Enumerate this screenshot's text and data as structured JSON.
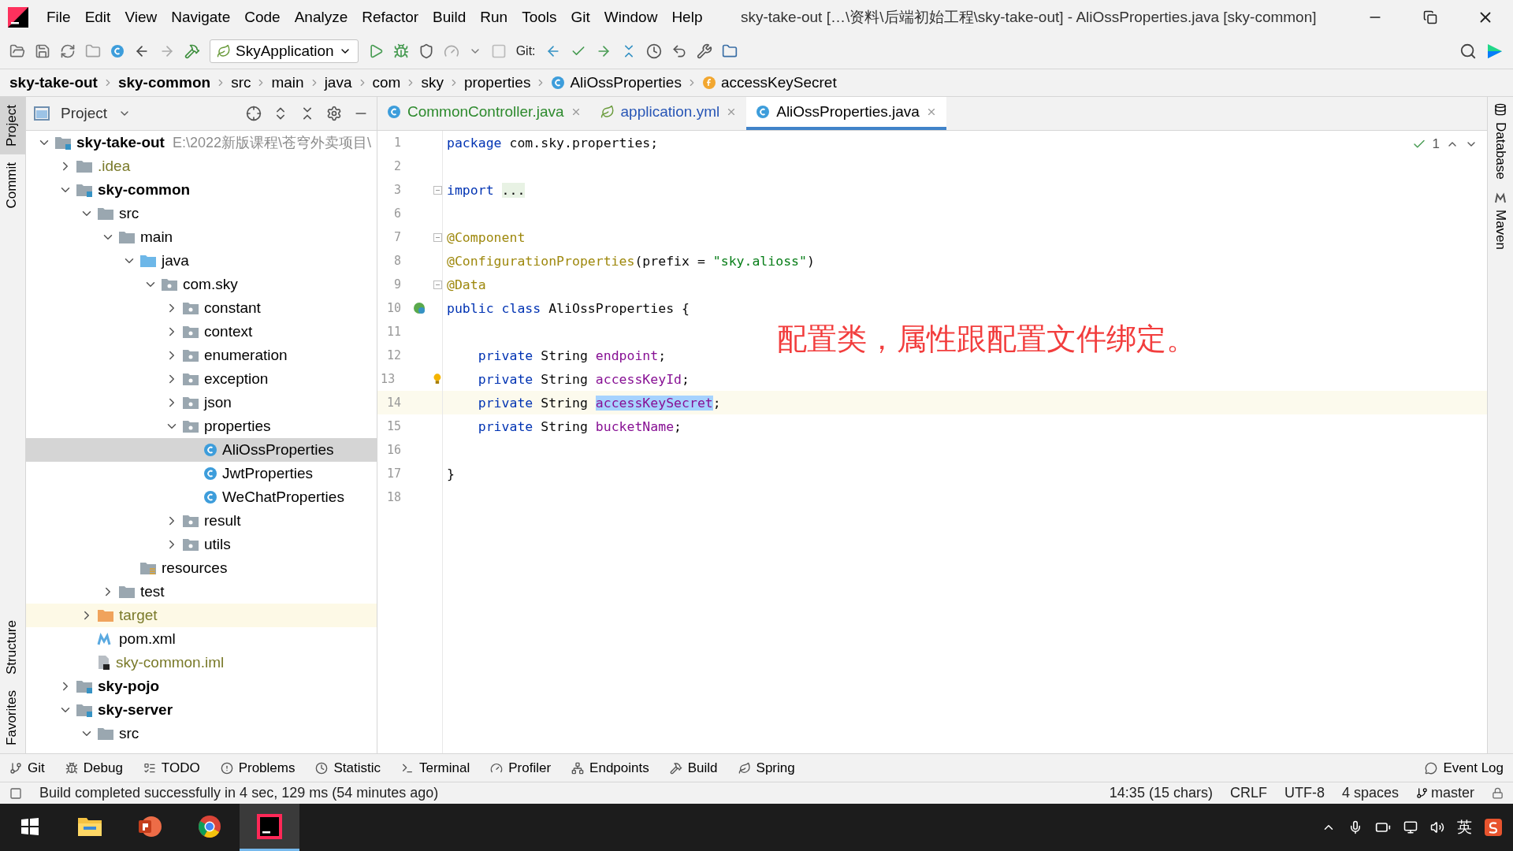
{
  "window": {
    "title": "sky-take-out […\\资料\\后端初始工程\\sky-take-out] - AliOssProperties.java [sky-common]",
    "menu": [
      "File",
      "Edit",
      "View",
      "Navigate",
      "Code",
      "Analyze",
      "Refactor",
      "Build",
      "Run",
      "Tools",
      "Git",
      "Window",
      "Help"
    ]
  },
  "toolbar": {
    "run_config": "SkyApplication",
    "git_label": "Git:"
  },
  "breadcrumbs": [
    {
      "label": "sky-take-out",
      "kind": "module"
    },
    {
      "label": "sky-common",
      "kind": "module"
    },
    {
      "label": "src",
      "kind": "dir"
    },
    {
      "label": "main",
      "kind": "dir"
    },
    {
      "label": "java",
      "kind": "dir"
    },
    {
      "label": "com",
      "kind": "dir"
    },
    {
      "label": "sky",
      "kind": "dir"
    },
    {
      "label": "properties",
      "kind": "dir"
    },
    {
      "label": "AliOssProperties",
      "kind": "class"
    },
    {
      "label": "accessKeySecret",
      "kind": "field"
    }
  ],
  "left_stripe": {
    "top": [
      {
        "label": "Project",
        "selected": true
      },
      {
        "label": "Commit",
        "selected": false
      }
    ],
    "bottom": [
      {
        "label": "Structure",
        "selected": false
      },
      {
        "label": "Favorites",
        "selected": false
      }
    ]
  },
  "project": {
    "title": "Project",
    "tree": [
      {
        "label": "sky-take-out",
        "kind": "module",
        "path": "E:\\2022新版课程\\苍穹外卖项目\\",
        "expanded": true,
        "selected": false,
        "ignored": false,
        "children": [
          {
            "label": ".idea",
            "kind": "folder",
            "expanded": false,
            "selected": false,
            "ignored": true
          },
          {
            "label": "sky-common",
            "kind": "module",
            "expanded": true,
            "selected": false,
            "ignored": false,
            "children": [
              {
                "label": "src",
                "kind": "folder",
                "expanded": true,
                "selected": false,
                "ignored": false,
                "children": [
                  {
                    "label": "main",
                    "kind": "folder",
                    "expanded": true,
                    "selected": false,
                    "ignored": false,
                    "children": [
                      {
                        "label": "java",
                        "kind": "source",
                        "expanded": true,
                        "selected": false,
                        "ignored": false,
                        "children": [
                          {
                            "label": "com.sky",
                            "kind": "package",
                            "expanded": true,
                            "selected": false,
                            "ignored": false,
                            "children": [
                              {
                                "label": "constant",
                                "kind": "package",
                                "expanded": false,
                                "selected": false,
                                "ignored": false
                              },
                              {
                                "label": "context",
                                "kind": "package",
                                "expanded": false,
                                "selected": false,
                                "ignored": false
                              },
                              {
                                "label": "enumeration",
                                "kind": "package",
                                "expanded": false,
                                "selected": false,
                                "ignored": false
                              },
                              {
                                "label": "exception",
                                "kind": "package",
                                "expanded": false,
                                "selected": false,
                                "ignored": false
                              },
                              {
                                "label": "json",
                                "kind": "package",
                                "expanded": false,
                                "selected": false,
                                "ignored": false
                              },
                              {
                                "label": "properties",
                                "kind": "package",
                                "expanded": true,
                                "selected": false,
                                "ignored": false,
                                "children": [
                                  {
                                    "label": "AliOssProperties",
                                    "kind": "class",
                                    "selected": true,
                                    "ignored": false
                                  },
                                  {
                                    "label": "JwtProperties",
                                    "kind": "class",
                                    "selected": false,
                                    "ignored": false
                                  },
                                  {
                                    "label": "WeChatProperties",
                                    "kind": "class",
                                    "selected": false,
                                    "ignored": false
                                  }
                                ]
                              },
                              {
                                "label": "result",
                                "kind": "package",
                                "expanded": false,
                                "selected": false,
                                "ignored": false
                              },
                              {
                                "label": "utils",
                                "kind": "package",
                                "expanded": false,
                                "selected": false,
                                "ignored": false
                              }
                            ]
                          }
                        ]
                      },
                      {
                        "label": "resources",
                        "kind": "resources",
                        "selected": false,
                        "ignored": false
                      }
                    ]
                  },
                  {
                    "label": "test",
                    "kind": "folder",
                    "expanded": false,
                    "selected": false,
                    "ignored": false
                  }
                ]
              },
              {
                "label": "target",
                "kind": "excluded",
                "expanded": false,
                "selected": false,
                "ignored": true
              },
              {
                "label": "pom.xml",
                "kind": "maven",
                "selected": false,
                "ignored": false
              },
              {
                "label": "sky-common.iml",
                "kind": "iml",
                "selected": false,
                "ignored": true
              }
            ]
          },
          {
            "label": "sky-pojo",
            "kind": "module",
            "expanded": false,
            "selected": false,
            "ignored": false
          },
          {
            "label": "sky-server",
            "kind": "module",
            "expanded": true,
            "selected": false,
            "ignored": false,
            "children": [
              {
                "label": "src",
                "kind": "folder",
                "expanded": true,
                "selected": false,
                "ignored": false
              }
            ]
          }
        ]
      }
    ]
  },
  "editor": {
    "tabs": [
      {
        "label": "CommonController.java",
        "kind": "java",
        "color": "#2d8a2d",
        "selected": false
      },
      {
        "label": "application.yml",
        "kind": "yml",
        "color": "#2856b6",
        "selected": false
      },
      {
        "label": "AliOssProperties.java",
        "kind": "java",
        "color": "#000000",
        "selected": true
      }
    ],
    "problems": "1",
    "lines": [
      {
        "number": "1",
        "kind": "plain",
        "current": false,
        "fold": false,
        "segments": [
          {
            "text": "package ",
            "kind": "keyword"
          },
          {
            "text": "com.sky.properties;",
            "kind": "plain"
          }
        ]
      },
      {
        "number": "2",
        "kind": "plain",
        "current": false,
        "fold": false
      },
      {
        "number": "3",
        "kind": "plain",
        "current": false,
        "fold": true,
        "segments": [
          {
            "text": "import ",
            "kind": "keyword"
          },
          {
            "text": "...",
            "kind": "folded"
          }
        ]
      },
      {
        "number": "6",
        "kind": "plain",
        "current": false,
        "fold": false
      },
      {
        "number": "7",
        "kind": "plain",
        "current": false,
        "fold": true,
        "segments": [
          {
            "text": "@Component",
            "kind": "annotation"
          }
        ]
      },
      {
        "number": "8",
        "kind": "plain",
        "current": false,
        "fold": false,
        "segments": [
          {
            "text": "@ConfigurationProperties",
            "kind": "annotation"
          },
          {
            "text": "(prefix = ",
            "kind": "plain"
          },
          {
            "text": "\"sky.alioss\"",
            "kind": "string"
          },
          {
            "text": ")",
            "kind": "plain"
          }
        ]
      },
      {
        "number": "9",
        "kind": "plain",
        "current": false,
        "fold": true,
        "segments": [
          {
            "text": "@Data",
            "kind": "annotation"
          }
        ]
      },
      {
        "number": "10",
        "kind": "bean",
        "current": false,
        "fold": false,
        "segments": [
          {
            "text": "public class ",
            "kind": "keyword"
          },
          {
            "text": "AliOssProperties {",
            "kind": "plain"
          }
        ]
      },
      {
        "number": "11",
        "kind": "plain",
        "current": false,
        "fold": false
      },
      {
        "number": "12",
        "kind": "plain",
        "current": false,
        "fold": false,
        "segments": [
          {
            "text": "    private ",
            "kind": "keyword"
          },
          {
            "text": "String ",
            "kind": "plain"
          },
          {
            "text": "endpoint",
            "kind": "field"
          },
          {
            "text": ";",
            "kind": "plain"
          }
        ]
      },
      {
        "number": "13",
        "kind": "bulb",
        "current": false,
        "fold": false,
        "segments": [
          {
            "text": "    private ",
            "kind": "keyword"
          },
          {
            "text": "String ",
            "kind": "plain"
          },
          {
            "text": "accessKeyId",
            "kind": "field"
          },
          {
            "text": ";",
            "kind": "plain"
          }
        ]
      },
      {
        "number": "14",
        "kind": "plain",
        "current": true,
        "fold": false,
        "segments": [
          {
            "text": "    private ",
            "kind": "keyword"
          },
          {
            "text": "String ",
            "kind": "plain"
          },
          {
            "text": "accessKeySecret",
            "kind": "selection"
          },
          {
            "text": ";",
            "kind": "plain"
          }
        ]
      },
      {
        "number": "15",
        "kind": "plain",
        "current": false,
        "fold": false,
        "segments": [
          {
            "text": "    private ",
            "kind": "keyword"
          },
          {
            "text": "String ",
            "kind": "plain"
          },
          {
            "text": "bucketName",
            "kind": "field"
          },
          {
            "text": ";",
            "kind": "plain"
          }
        ]
      },
      {
        "number": "16",
        "kind": "plain",
        "current": false,
        "fold": false
      },
      {
        "number": "17",
        "kind": "plain",
        "current": false,
        "fold": false,
        "segments": [
          {
            "text": "}",
            "kind": "plain"
          }
        ]
      },
      {
        "number": "18",
        "kind": "plain",
        "current": false,
        "fold": false
      }
    ],
    "annotation": "配置类，属性跟配置文件绑定。"
  },
  "right_stripe": [
    {
      "label": "Database",
      "kind": "database"
    },
    {
      "label": "Maven",
      "kind": "maven"
    }
  ],
  "bottom_tools": [
    {
      "label": "Git",
      "kind": "git"
    },
    {
      "label": "Debug",
      "kind": "debug"
    },
    {
      "label": "TODO",
      "kind": "todo"
    },
    {
      "label": "Problems",
      "kind": "problems"
    },
    {
      "label": "Statistic",
      "kind": "statistic"
    },
    {
      "label": "Terminal",
      "kind": "terminal"
    },
    {
      "label": "Profiler",
      "kind": "profiler"
    },
    {
      "label": "Endpoints",
      "kind": "endpoints"
    },
    {
      "label": "Build",
      "kind": "build"
    },
    {
      "label": "Spring",
      "kind": "spring"
    }
  ],
  "event_log": "Event Log",
  "status_bar": {
    "message": "Build completed successfully in 4 sec, 129 ms (54 minutes ago)",
    "position": "14:35 (15 chars)",
    "line_separator": "CRLF",
    "encoding": "UTF-8",
    "indent": "4 spaces",
    "branch": "master"
  },
  "taskbar": {
    "apps": [
      {
        "kind": "explorer",
        "selected": false
      },
      {
        "kind": "slides",
        "selected": false
      },
      {
        "kind": "browser",
        "selected": false
      },
      {
        "kind": "ide",
        "selected": true
      }
    ],
    "ime": "英"
  }
}
